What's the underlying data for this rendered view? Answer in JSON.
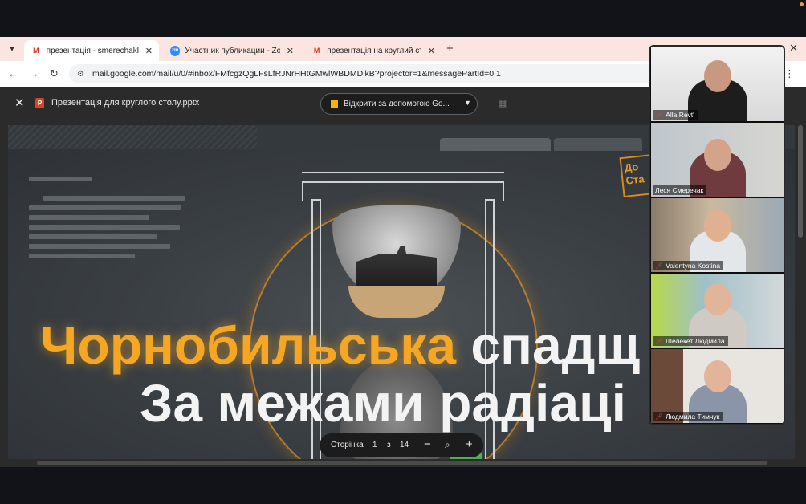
{
  "browser": {
    "tabs": [
      {
        "title": "презентація - smerechaklesya@",
        "icon": "gmail-icon"
      },
      {
        "title": "Участник публикации - Zoom",
        "icon": "zoom-icon"
      },
      {
        "title": "презентація на круглий стіл К",
        "icon": "gmail-icon"
      }
    ],
    "url": "mail.google.com/mail/u/0/#inbox/FMfcgzQgLFsLfRJNrHHtGMwlWBDMDlkB?projector=1&messagePartId=0.1"
  },
  "viewer": {
    "filename": "Презентація для круглого столу.pptx",
    "open_with_label": "Відкрити за допомогою Go...",
    "page_label": "Сторінка",
    "page_current": "1",
    "page_separator": "з",
    "page_total": "14"
  },
  "slide": {
    "title_orange": "Чорнобильська",
    "title_white": "спадщ",
    "subtitle": "За межами радіаці",
    "stamp_text": "До Ста"
  },
  "participants": [
    {
      "name": "Alla Revt'",
      "muted": true
    },
    {
      "name": "Леся Смеречак",
      "muted": false
    },
    {
      "name": "Valentyna Kostina",
      "muted": true
    },
    {
      "name": "Шелекет Людмила",
      "muted": true
    },
    {
      "name": "Людмила Тимчук",
      "muted": true
    }
  ],
  "colors": {
    "accent_orange": "#f5a623",
    "tab_strip": "#fbe5e0",
    "muted_red": "#e04040"
  }
}
